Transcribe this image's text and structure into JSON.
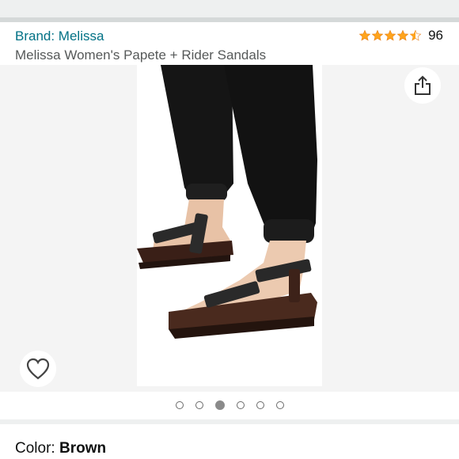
{
  "product": {
    "brand_link": "Brand: Melissa",
    "title": "Melissa Women's Papete + Rider Sandals",
    "rating": 4.5,
    "review_count": "96"
  },
  "gallery": {
    "image_count": 6,
    "current_index": 3,
    "image_alt": "product photo: black and brown strap sandals worn with black jogger pants"
  },
  "icons": {
    "share": "share-icon",
    "wishlist": "heart-icon",
    "rating_star": "star-icon"
  },
  "variation": {
    "label": "Color: ",
    "value": "Brown"
  },
  "colors": {
    "link": "#007185",
    "star": "#ffa41c",
    "text": "#0f1111",
    "muted": "#565959"
  }
}
